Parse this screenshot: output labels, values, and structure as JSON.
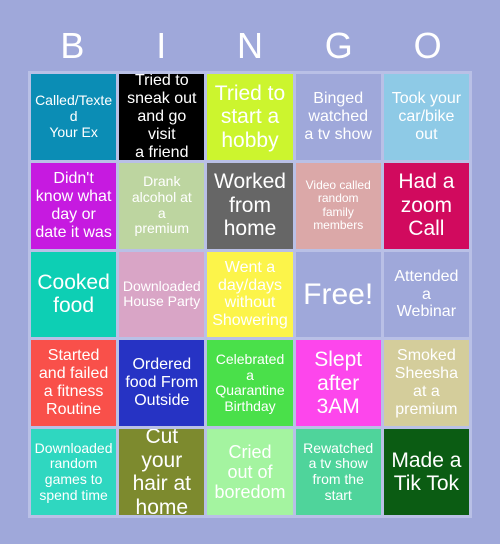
{
  "header": {
    "letters": [
      "B",
      "I",
      "N",
      "G",
      "O"
    ]
  },
  "page": {
    "background_color": "#9fa8da",
    "grid_line_color": "#b9c0e6",
    "title": "BINGO"
  },
  "card": {
    "rows": 5,
    "columns": 5,
    "cells": [
      {
        "text": "Called/Texted\nYour Ex",
        "bg": "#0b8db5",
        "fg": "#ffffff",
        "size": "fs-sm",
        "name": "bingo-cell-r1c1"
      },
      {
        "text": "Tried to\nsneak out\nand go visit\na friend",
        "bg": "#000000",
        "fg": "#ffffff",
        "size": "fs-md",
        "name": "bingo-cell-r1c2"
      },
      {
        "text": "Tried to\nstart a\nhobby",
        "bg": "#ccf52e",
        "fg": "#ffffff",
        "size": "fs-xl",
        "name": "bingo-cell-r1c3"
      },
      {
        "text": "Binged\nwatched\na tv show",
        "bg": "#9fa8da",
        "fg": "#ffffff",
        "size": "fs-md",
        "name": "bingo-cell-r1c4"
      },
      {
        "text": "Took your\ncar/bike\nout",
        "bg": "#8ecae6",
        "fg": "#ffffff",
        "size": "fs-md",
        "name": "bingo-cell-r1c5"
      },
      {
        "text": "Didn't\nknow what\nday or\ndate it was",
        "bg": "#c61ae0",
        "fg": "#ffffff",
        "size": "fs-md",
        "name": "bingo-cell-r2c1"
      },
      {
        "text": "Drank\nalcohol at\na\npremium",
        "bg": "#bdd5a0",
        "fg": "#ffffff",
        "size": "fs-sm",
        "name": "bingo-cell-r2c2"
      },
      {
        "text": "Worked\nfrom\nhome",
        "bg": "#666666",
        "fg": "#ffffff",
        "size": "fs-xl",
        "name": "bingo-cell-r2c3"
      },
      {
        "text": "Video called\nrandom\nfamily\nmembers",
        "bg": "#dba8a8",
        "fg": "#ffffff",
        "size": "fs-xs",
        "name": "bingo-cell-r2c4"
      },
      {
        "text": "Had a\nzoom\nCall",
        "bg": "#d10a5e",
        "fg": "#ffffff",
        "size": "fs-xl",
        "name": "bingo-cell-r2c5"
      },
      {
        "text": "Cooked\nfood",
        "bg": "#0dcfb4",
        "fg": "#ffffff",
        "size": "fs-xl",
        "name": "bingo-cell-r3c1"
      },
      {
        "text": "Downloaded\nHouse Party",
        "bg": "#d9a5c6",
        "fg": "#ffffff",
        "size": "fs-sm",
        "name": "bingo-cell-r3c2"
      },
      {
        "text": "Went a\nday/days\nwithout\nShowering",
        "bg": "#fcf44a",
        "fg": "#ffffff",
        "size": "fs-md",
        "name": "bingo-cell-r3c3"
      },
      {
        "text": "Free!",
        "bg": "#9fa8da",
        "fg": "#ffffff",
        "size": "fs-xxl",
        "name": "bingo-cell-free"
      },
      {
        "text": "Attended\na\nWebinar",
        "bg": "#9fa8da",
        "fg": "#ffffff",
        "size": "fs-md",
        "name": "bingo-cell-r3c5"
      },
      {
        "text": "Started\nand failed\na fitness\nRoutine",
        "bg": "#f9504a",
        "fg": "#ffffff",
        "size": "fs-md",
        "name": "bingo-cell-r4c1"
      },
      {
        "text": "Ordered\nfood From\nOutside",
        "bg": "#2633c4",
        "fg": "#ffffff",
        "size": "fs-md",
        "name": "bingo-cell-r4c2"
      },
      {
        "text": "Celebrated\na\nQuarantine\nBirthday",
        "bg": "#4ae04a",
        "fg": "#ffffff",
        "size": "fs-sm",
        "name": "bingo-cell-r4c3"
      },
      {
        "text": "Slept\nafter\n3AM",
        "bg": "#fd46ec",
        "fg": "#ffffff",
        "size": "fs-xl",
        "name": "bingo-cell-r4c4"
      },
      {
        "text": "Smoked\nSheesha\nat a\npremium",
        "bg": "#d4cd9b",
        "fg": "#ffffff",
        "size": "fs-md",
        "name": "bingo-cell-r4c5"
      },
      {
        "text": "Downloaded\nrandom\ngames to\nspend time",
        "bg": "#2fd7c0",
        "fg": "#ffffff",
        "size": "fs-sm",
        "name": "bingo-cell-r5c1"
      },
      {
        "text": "Cut your\nhair at\nhome",
        "bg": "#7d8a2e",
        "fg": "#ffffff",
        "size": "fs-xl",
        "name": "bingo-cell-r5c2"
      },
      {
        "text": "Cried\nout of\nboredom",
        "bg": "#a4f4a0",
        "fg": "#ffffff",
        "size": "fs-lg",
        "name": "bingo-cell-r5c3"
      },
      {
        "text": "Rewatched\na tv show\nfrom the\nstart",
        "bg": "#4fd49b",
        "fg": "#ffffff",
        "size": "fs-sm",
        "name": "bingo-cell-r5c4"
      },
      {
        "text": "Made a\nTik Tok",
        "bg": "#0b5c13",
        "fg": "#ffffff",
        "size": "fs-xl",
        "name": "bingo-cell-r5c5"
      }
    ]
  }
}
